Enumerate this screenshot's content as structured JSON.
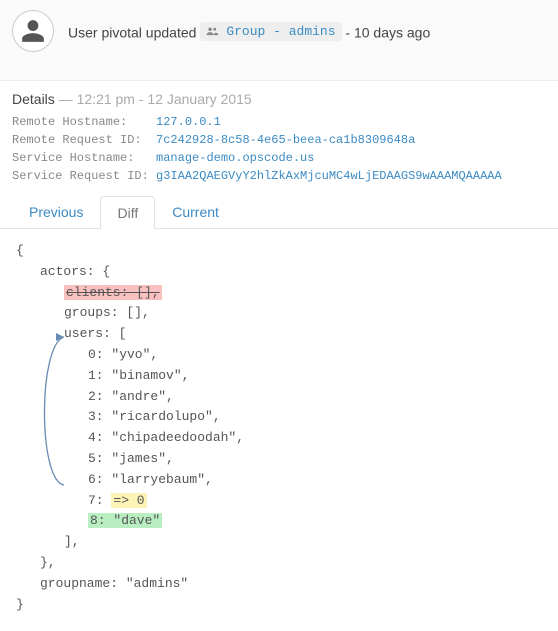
{
  "header": {
    "prefix": "User pivotal updated",
    "group_label": "Group - admins",
    "suffix": "- 10 days ago"
  },
  "details": {
    "label": "Details",
    "dash": " — ",
    "time": "12:21 pm - 12 January 2015"
  },
  "meta": {
    "remote_hostname_label": "Remote Hostname:   ",
    "remote_hostname": "127.0.0.1",
    "remote_request_label": "Remote Request ID: ",
    "remote_request": "7c242928-8c58-4e65-beea-ca1b8309648a",
    "service_hostname_label": "Service Hostname:  ",
    "service_hostname": "manage-demo.opscode.us",
    "service_request_label": "Service Request ID:",
    "service_request": "g3IAA2QAEGVyY2hlZkAxMjcuMC4wLjEDAAGS9wAAAMQAAAAA"
  },
  "tabs": {
    "previous": "Previous",
    "diff": "Diff",
    "current": "Current"
  },
  "diff": {
    "open": "{",
    "actors_open": "actors: {",
    "removed_clients": "clients: [],",
    "groups_line": "groups: [],",
    "users_open": "users: [",
    "u0": "0: \"yvo\",",
    "u1": "1: \"binamov\",",
    "u2": "2: \"andre\",",
    "u3": "3: \"ricardolupo\",",
    "u4": "4: \"chipadeedoodah\",",
    "u5": "5: \"james\",",
    "u6": "6: \"larryebaum\",",
    "u7a": "7: ",
    "u7b": "=> 0",
    "u8": "8: \"dave\"",
    "users_close": "],",
    "actors_close": "},",
    "groupname": "groupname: \"admins\"",
    "close": "}"
  }
}
